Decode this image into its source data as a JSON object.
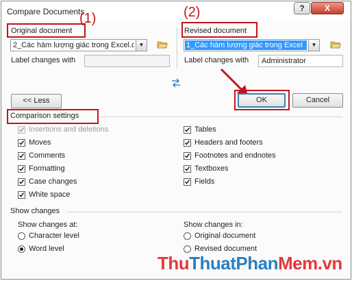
{
  "window": {
    "title": "Compare Documents"
  },
  "titlebar": {
    "help_label": "?",
    "close_label": "X"
  },
  "annotations": {
    "one": "(1)",
    "two": "(2)"
  },
  "original": {
    "heading": "Original document",
    "selected": "2_Các hàm lượng giác trong Excel.d",
    "label_caption": "Label changes with",
    "label_value": ""
  },
  "revised": {
    "heading": "Revised document",
    "selected": "1_Các hàm lượng giác trong Excel",
    "label_caption": "Label changes with",
    "label_value": "Administrator"
  },
  "swap_icon": "swap-arrows-icon",
  "buttons": {
    "less": "<< Less",
    "ok": "OK",
    "cancel": "Cancel"
  },
  "comparison": {
    "heading": "Comparison settings",
    "left": [
      {
        "label": "Insertions and deletions",
        "checked": true,
        "disabled": true
      },
      {
        "label": "Moves",
        "checked": true
      },
      {
        "label": "Comments",
        "checked": true
      },
      {
        "label": "Formatting",
        "checked": true
      },
      {
        "label": "Case changes",
        "checked": true
      },
      {
        "label": "White space",
        "checked": true
      }
    ],
    "right": [
      {
        "label": "Tables",
        "checked": true
      },
      {
        "label": "Headers and footers",
        "checked": true
      },
      {
        "label": "Footnotes and endnotes",
        "checked": true
      },
      {
        "label": "Textboxes",
        "checked": true
      },
      {
        "label": "Fields",
        "checked": true
      }
    ]
  },
  "show_changes": {
    "heading": "Show changes",
    "at_label": "Show changes at:",
    "at_options": [
      {
        "label": "Character level",
        "selected": false
      },
      {
        "label": "Word level",
        "selected": true
      }
    ],
    "in_label": "Show changes in:",
    "in_options": [
      {
        "label": "Original document",
        "selected": false
      },
      {
        "label": "Revised document",
        "selected": false
      }
    ]
  },
  "watermark": {
    "part1": "Thu",
    "part2": "ThuatPhan",
    "part3": "Mem.vn"
  },
  "colors": {
    "annotation_red": "#c0141b",
    "selection_blue": "#3399ff",
    "default_button_border": "#3c7fb1"
  }
}
